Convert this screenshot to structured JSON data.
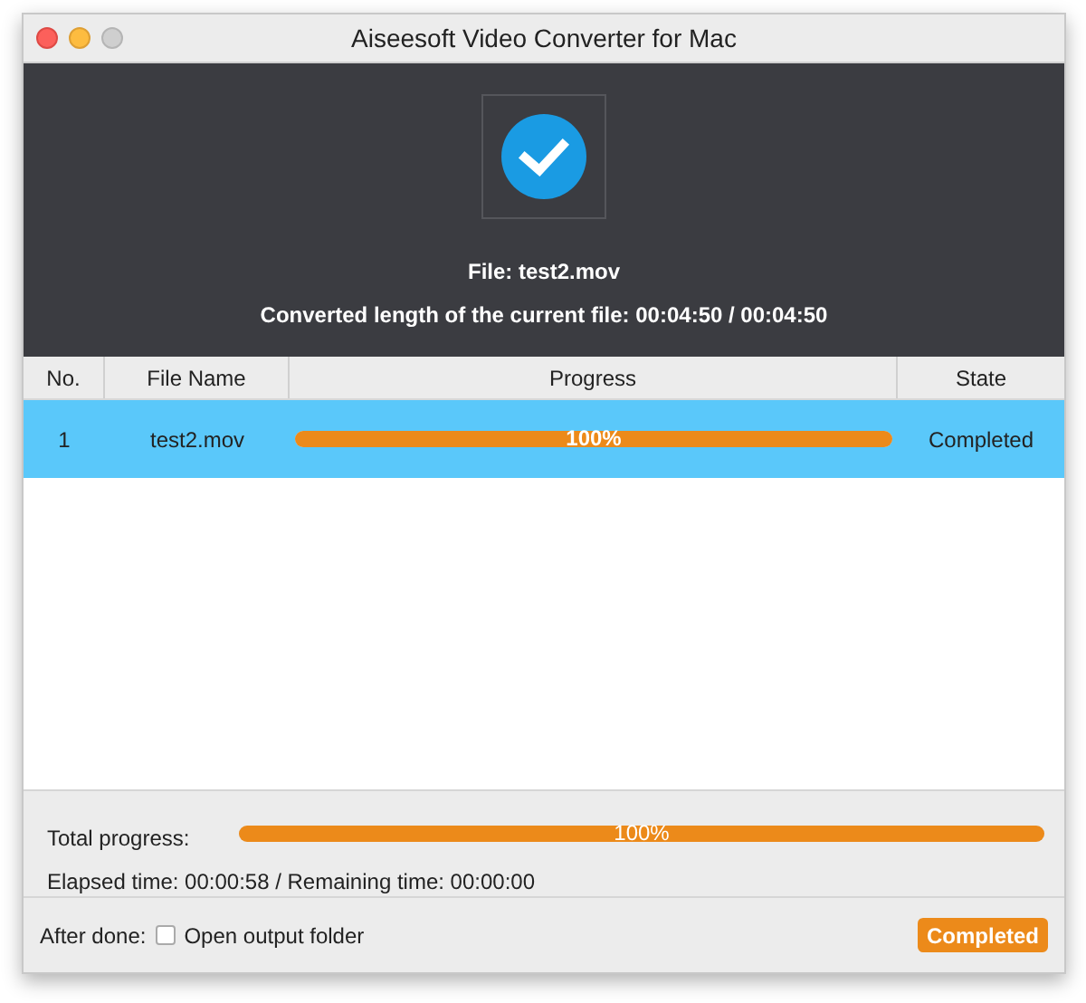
{
  "window": {
    "title": "Aiseesoft Video Converter for Mac"
  },
  "summary": {
    "file": "File: test2.mov",
    "converted": "Converted length of the current file: 00:04:50 / 00:04:50"
  },
  "table": {
    "columns": [
      "No.",
      "File Name",
      "Progress",
      "State"
    ],
    "rows": [
      {
        "no": "1",
        "file_name": "test2.mov",
        "level": 1,
        "progress_text": "100%",
        "state": "Completed",
        "selected": true
      }
    ]
  },
  "total": {
    "label": "Total progress:",
    "level": 1,
    "progress_text": "100%",
    "times": "Elapsed time: 00:00:58 / Remaining time: 00:00:00"
  },
  "footer": {
    "after_done": "After done:",
    "open_folder": {
      "label": "Open output folder",
      "checked": false
    },
    "button": "Completed"
  }
}
